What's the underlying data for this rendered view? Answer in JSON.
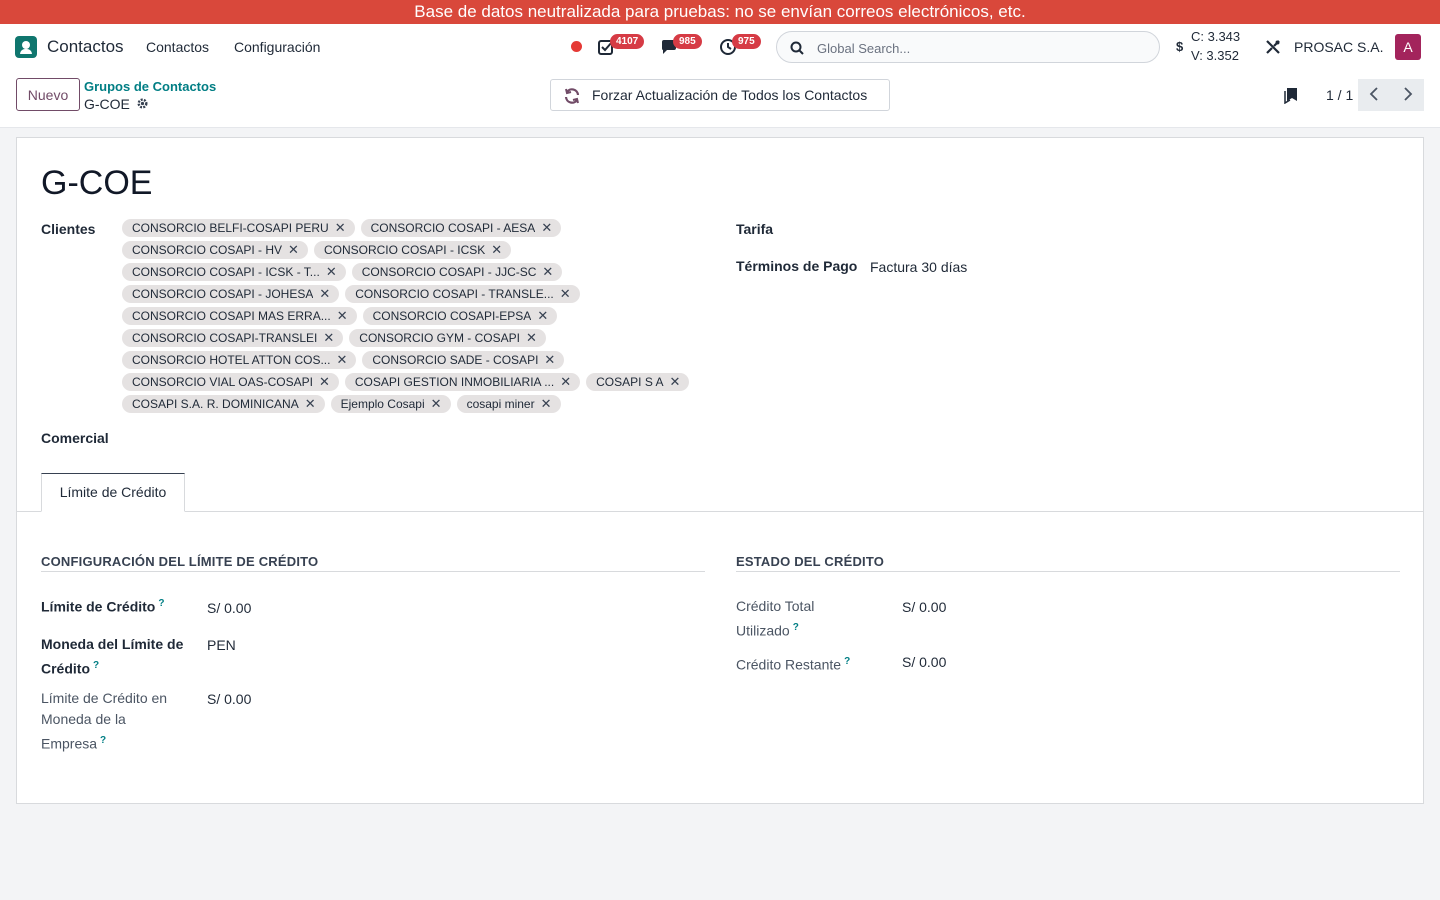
{
  "banner": {
    "text": "Base de datos neutralizada para pruebas: no se envían correos electrónicos, etc."
  },
  "navbar": {
    "app_name": "Contactos",
    "menu": [
      "Contactos",
      "Configuración"
    ],
    "badges": {
      "activities": "4107",
      "messages": "985",
      "timesheets": "975"
    },
    "search_placeholder": "Global Search...",
    "currency_symbol": "$",
    "rate_buy": "C: 3.343",
    "rate_sell": "V: 3.352",
    "company": "PROSAC S.A.",
    "avatar_letter": "A",
    "avatar_color": "#a3245c"
  },
  "control_panel": {
    "new_button": "Nuevo",
    "breadcrumb_parent": "Grupos de Contactos",
    "breadcrumb_current": "G-COE",
    "refresh_button": "Forzar Actualización de Todos los Contactos",
    "pager": "1 / 1"
  },
  "form": {
    "title": "G-COE",
    "clientes_label": "Clientes",
    "comercial_label": "Comercial",
    "tarifa_label": "Tarifa",
    "terminos_label": "Términos de Pago",
    "terminos_value": "Factura 30 días",
    "clientes": [
      "CONSORCIO BELFI-COSAPI PERU",
      "CONSORCIO COSAPI - AESA",
      "CONSORCIO COSAPI - HV",
      "CONSORCIO COSAPI - ICSK",
      "CONSORCIO COSAPI - ICSK - T...",
      "CONSORCIO COSAPI - JJC-SC",
      "CONSORCIO COSAPI - JOHESA",
      "CONSORCIO COSAPI - TRANSLE...",
      "CONSORCIO COSAPI MAS ERRA...",
      "CONSORCIO COSAPI-EPSA",
      "CONSORCIO COSAPI-TRANSLEI",
      "CONSORCIO GYM - COSAPI",
      "CONSORCIO HOTEL ATTON COS...",
      "CONSORCIO SADE - COSAPI",
      "CONSORCIO VIAL OAS-COSAPI",
      "COSAPI GESTION INMOBILIARIA ...",
      "COSAPI S A",
      "COSAPI S.A. R. DOMINICANA",
      "Ejemplo Cosapi",
      "cosapi miner"
    ]
  },
  "tab": {
    "label": "Límite de Crédito"
  },
  "credit_config": {
    "title": "CONFIGURACIÓN DEL LÍMITE DE CRÉDITO",
    "limite_label": "Límite de Crédito",
    "limite_value": "S/ 0.00",
    "moneda_label_1": "Moneda del Límite de",
    "moneda_label_2": "Crédito",
    "moneda_value": "PEN",
    "empresa_label_1": "Límite de Crédito en",
    "empresa_label_2": "Moneda de la",
    "empresa_label_3": "Empresa",
    "empresa_value": "S/ 0.00"
  },
  "credit_status": {
    "title": "ESTADO DEL CRÉDITO",
    "total_label_1": "Crédito Total",
    "total_label_2": "Utilizado",
    "total_value": "S/ 0.00",
    "restante_label": "Crédito Restante",
    "restante_value": "S/ 0.00"
  },
  "help_mark": "?",
  "icons": [
    "contacts-app-icon",
    "checkbox-activity-icon",
    "chat-icon",
    "clock-icon",
    "search-icon",
    "tools-icon",
    "gear-icon",
    "refresh-icon",
    "bookmark-icon",
    "chevron-left-icon",
    "chevron-right-icon",
    "close-icon"
  ]
}
